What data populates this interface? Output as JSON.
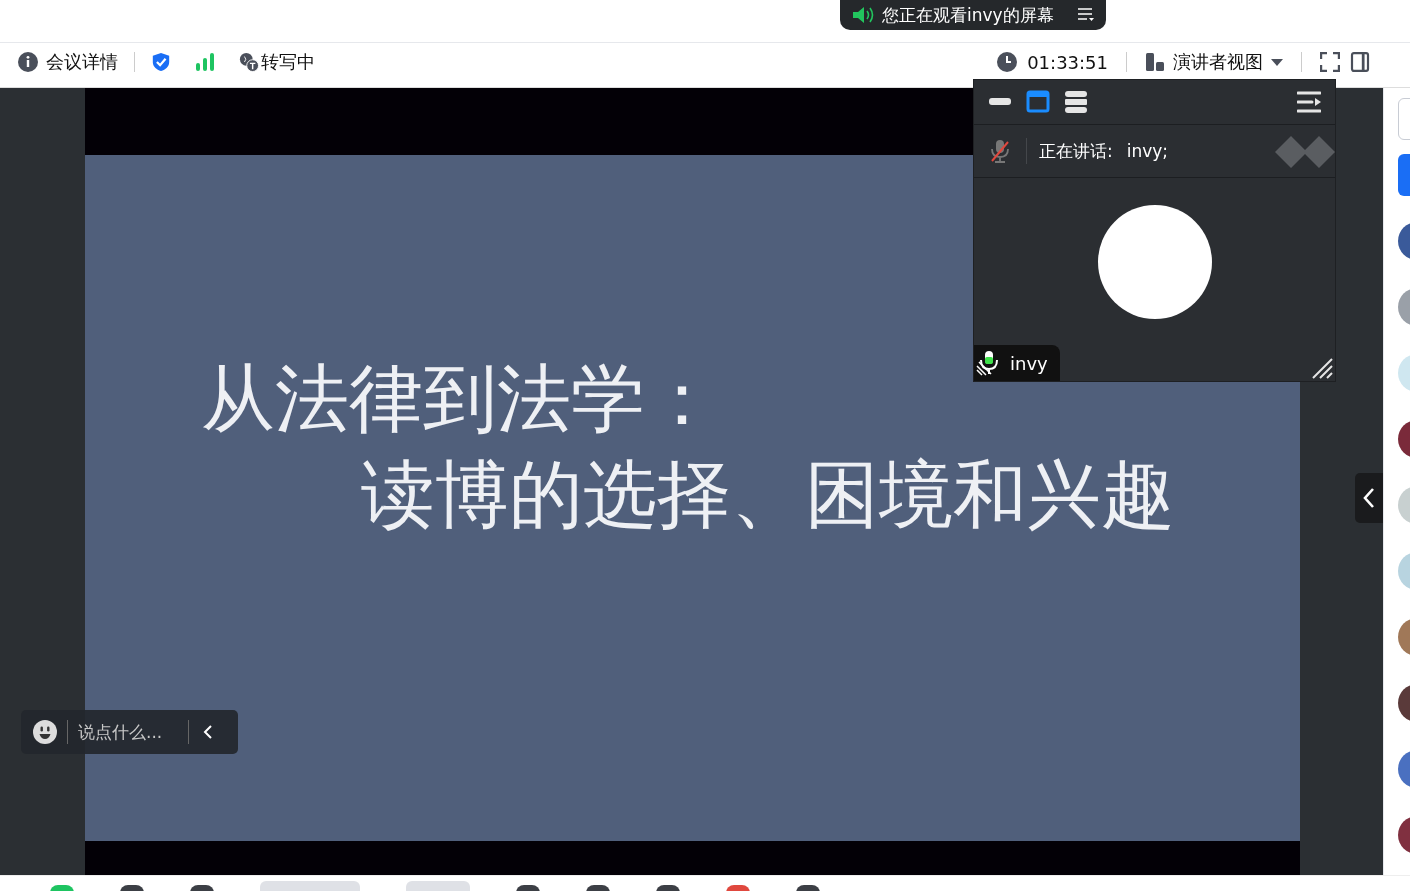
{
  "banner": {
    "text": "您正在观看invy的屏幕"
  },
  "toolbar": {
    "meeting_info": "会议详情",
    "transcription": "转写中",
    "timer": "01:33:51",
    "view_mode": "演讲者视图"
  },
  "slide": {
    "title_line_1": "从法律到法学：",
    "title_line_2": "读博的选择、困境和兴趣"
  },
  "video_panel": {
    "layout_modes": [
      {
        "kind": "minimize",
        "selected": false
      },
      {
        "kind": "window",
        "selected": true
      },
      {
        "kind": "list",
        "selected": false
      }
    ],
    "mic_muted": true,
    "speaking_label": "正在讲话:",
    "speaker": "invy;",
    "participant_name": "invy"
  },
  "chat": {
    "placeholder": "说点什么..."
  }
}
